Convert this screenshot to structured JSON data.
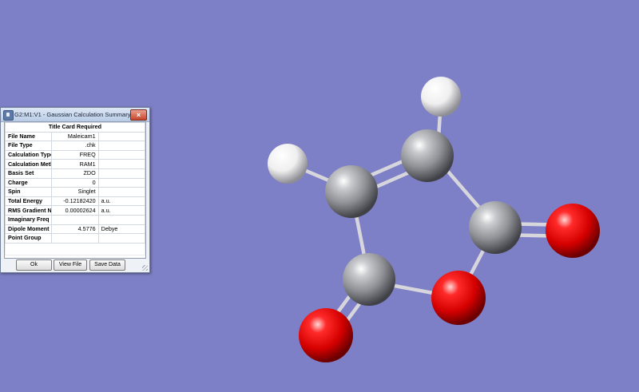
{
  "window": {
    "title": "G2:M1:V1 - Gaussian Calculation Summary",
    "close_glyph": "×",
    "icon": "app-icon"
  },
  "summary": {
    "header": "Title Card Required",
    "rows": [
      {
        "label": "File Name",
        "value": "Maleicam1",
        "unit": ""
      },
      {
        "label": "File Type",
        "value": ".chk",
        "unit": ""
      },
      {
        "label": "Calculation Type",
        "value": "FREQ",
        "unit": ""
      },
      {
        "label": "Calculation Method",
        "value": "RAM1",
        "unit": ""
      },
      {
        "label": "Basis Set",
        "value": "ZDO",
        "unit": ""
      },
      {
        "label": "Charge",
        "value": "0",
        "unit": ""
      },
      {
        "label": "Spin",
        "value": "Singlet",
        "unit": ""
      },
      {
        "label": "Total Energy",
        "value": "-0.12182420",
        "unit": "a.u."
      },
      {
        "label": "RMS Gradient Norm",
        "value": "0.00002624",
        "unit": "a.u."
      },
      {
        "label": "Imaginary Freq",
        "value": "",
        "unit": ""
      },
      {
        "label": "Dipole Moment",
        "value": "4.5776",
        "unit": "Debye"
      },
      {
        "label": "Point Group",
        "value": "",
        "unit": ""
      }
    ]
  },
  "buttons": {
    "ok": "Ok",
    "view_file": "View File",
    "save_data": "Save Data"
  },
  "molecule": {
    "background": "#7e80c7",
    "element_colors": {
      "C": "#8f9196",
      "O": "#e00000",
      "H": "#f4f4f4"
    },
    "atoms": [
      "H",
      "C",
      "H",
      "C",
      "C",
      "O",
      "C",
      "O",
      "O"
    ]
  }
}
